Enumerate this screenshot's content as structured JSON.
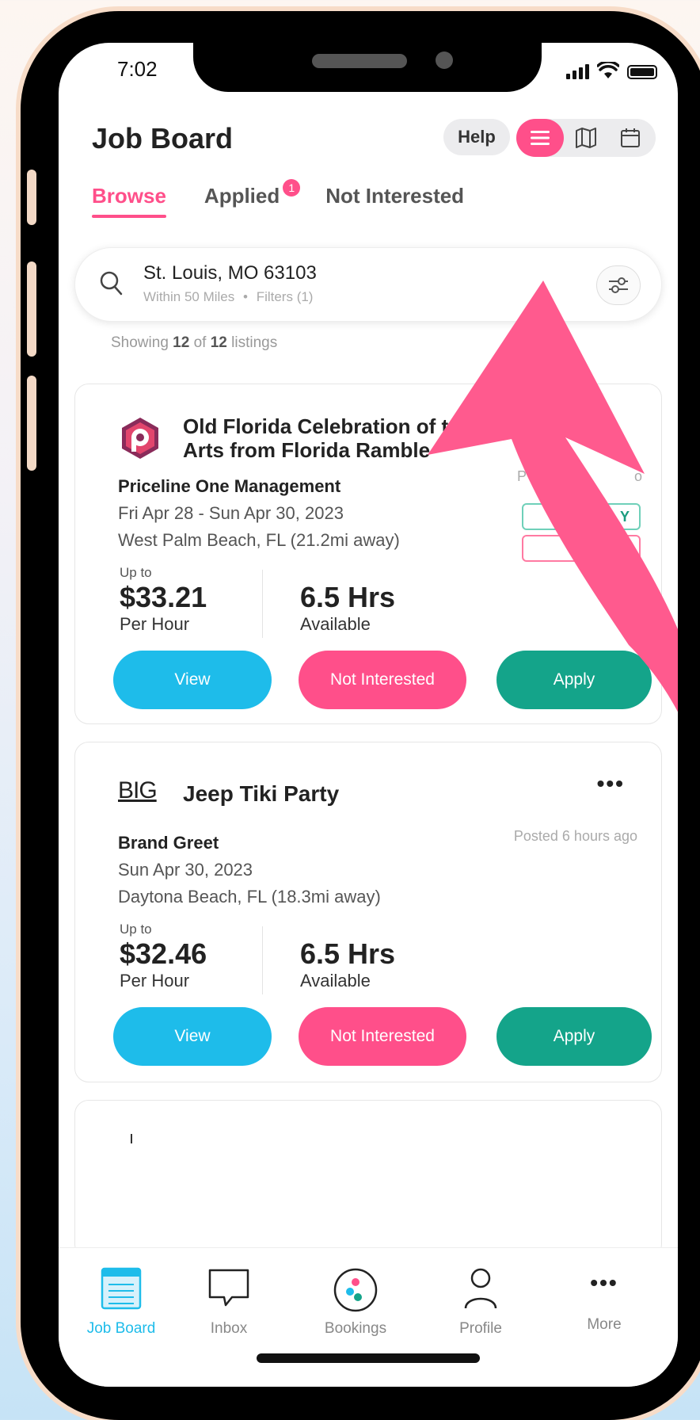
{
  "status": {
    "time": "7:02"
  },
  "header": {
    "title": "Job Board",
    "help_label": "Help"
  },
  "tabs": [
    {
      "label": "Browse",
      "active": true
    },
    {
      "label": "Applied",
      "badge": "1"
    },
    {
      "label": "Not Interested"
    }
  ],
  "search": {
    "location": "St. Louis, MO 63103",
    "radius": "Within 50 Miles",
    "separator": "•",
    "filters": "Filters (1)"
  },
  "listing_count": {
    "prefix": "Showing",
    "shown": "12",
    "of": "of",
    "total": "12",
    "suffix": "listings"
  },
  "jobs": [
    {
      "title_line1": "Old Florida Celebration of t",
      "title_line2": "Arts from Florida Ramble",
      "company": "Priceline One Management",
      "dates": "Fri Apr 28 - Sun Apr 30, 2023",
      "location": "West Palm Beach, FL (21.2mi away)",
      "posted": "P",
      "posted_tail": "o",
      "tag1": "Y",
      "up_to": "Up to",
      "rate": "$33.21",
      "rate_unit": "Per Hour",
      "hours": "6.5 Hrs",
      "hours_unit": "Available",
      "view_label": "View",
      "not_interested_label": "Not Interested",
      "apply_label": "Apply"
    },
    {
      "logo_text": "BIG",
      "title_line1": "Jeep Tiki Party",
      "company": "Brand Greet",
      "dates": "Sun Apr 30, 2023",
      "location": "Daytona Beach, FL (18.3mi away)",
      "posted": "Posted 6 hours ago",
      "more": "•••",
      "up_to": "Up to",
      "rate": "$32.46",
      "rate_unit": "Per Hour",
      "hours": "6.5 Hrs",
      "hours_unit": "Available",
      "view_label": "View",
      "not_interested_label": "Not Interested",
      "apply_label": "Apply"
    }
  ],
  "nav": [
    {
      "label": "Job Board",
      "icon": "job-board-icon",
      "active": true
    },
    {
      "label": "Inbox",
      "icon": "chat-bubble-icon"
    },
    {
      "label": "Bookings",
      "icon": "bookings-icon"
    },
    {
      "label": "Profile",
      "icon": "person-icon"
    },
    {
      "label": "More",
      "icon": "more-dots-icon"
    }
  ],
  "colors": {
    "accent": "#ff4f8a",
    "view": "#1ebcea",
    "apply": "#14a48a",
    "arrow": "#ff5a8e"
  }
}
